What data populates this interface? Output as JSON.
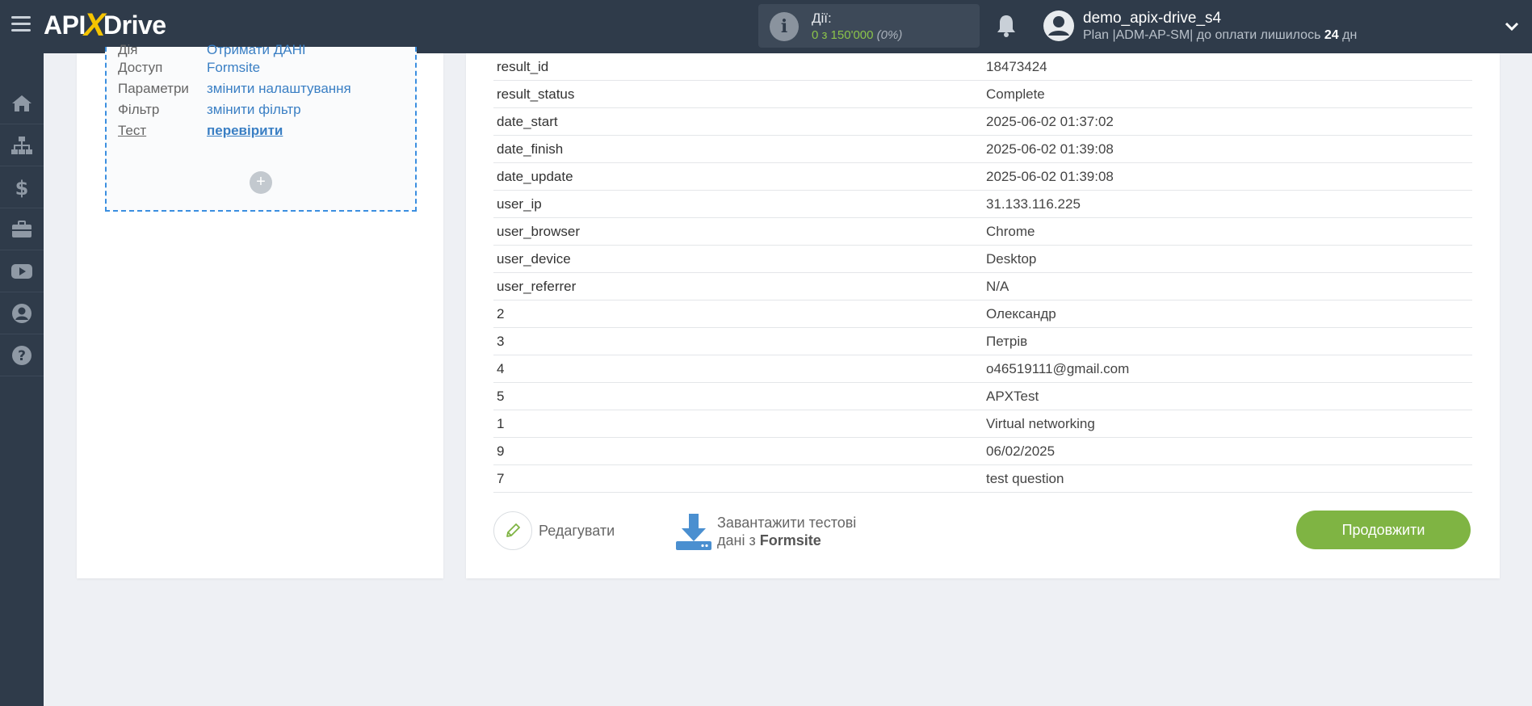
{
  "header": {
    "logo_left": "API",
    "logo_x": "X",
    "logo_right": "Drive",
    "actions_label": "Дії:",
    "actions_used": "0 з 150'000",
    "actions_percent": "(0%)",
    "user_name": "demo_apix-drive_s4",
    "plan_text": "Plan |ADM-AP-SM| до оплати лишилось",
    "days_left": "24",
    "days_unit": "дн"
  },
  "sidebar": {
    "items": [
      "home-icon",
      "sitemap-icon",
      "dollar-icon",
      "briefcase-icon",
      "youtube-icon",
      "user-icon",
      "help-icon"
    ]
  },
  "source": {
    "rows": [
      {
        "key": "Дія",
        "value": "Отримати ДАНІ"
      },
      {
        "key": "Доступ",
        "value": "Formsite"
      },
      {
        "key": "Параметри",
        "value": "змінити налаштування"
      },
      {
        "key": "Фільтр",
        "value": "змінити фільтр"
      },
      {
        "key": "Тест",
        "value": "перевірити"
      }
    ],
    "add_label": "+"
  },
  "result": {
    "rows": [
      {
        "field": "result_id",
        "value": "18473424"
      },
      {
        "field": "result_status",
        "value": "Complete"
      },
      {
        "field": "date_start",
        "value": "2025-06-02 01:37:02"
      },
      {
        "field": "date_finish",
        "value": "2025-06-02 01:39:08"
      },
      {
        "field": "date_update",
        "value": "2025-06-02 01:39:08"
      },
      {
        "field": "user_ip",
        "value": "31.133.116.225"
      },
      {
        "field": "user_browser",
        "value": "Chrome"
      },
      {
        "field": "user_device",
        "value": "Desktop"
      },
      {
        "field": "user_referrer",
        "value": "N/A"
      },
      {
        "field": "2",
        "value": "Олександр"
      },
      {
        "field": "3",
        "value": "Петрів"
      },
      {
        "field": "4",
        "value": "o46519111@gmail.com"
      },
      {
        "field": "5",
        "value": "APXTest"
      },
      {
        "field": "1",
        "value": "Virtual networking"
      },
      {
        "field": "9",
        "value": "06/02/2025"
      },
      {
        "field": "7",
        "value": "test question"
      }
    ]
  },
  "buttons": {
    "edit": "Редагувати",
    "download_line1": "Завантажити тестові",
    "download_line2_prefix": "дані з",
    "download_source": "Formsite",
    "continue": "Продовжити"
  },
  "colors": {
    "topbar": "#2f3b4a",
    "accent_green": "#7fb443",
    "link_blue": "#3a7fc4",
    "logo_yellow": "#f5c400"
  }
}
